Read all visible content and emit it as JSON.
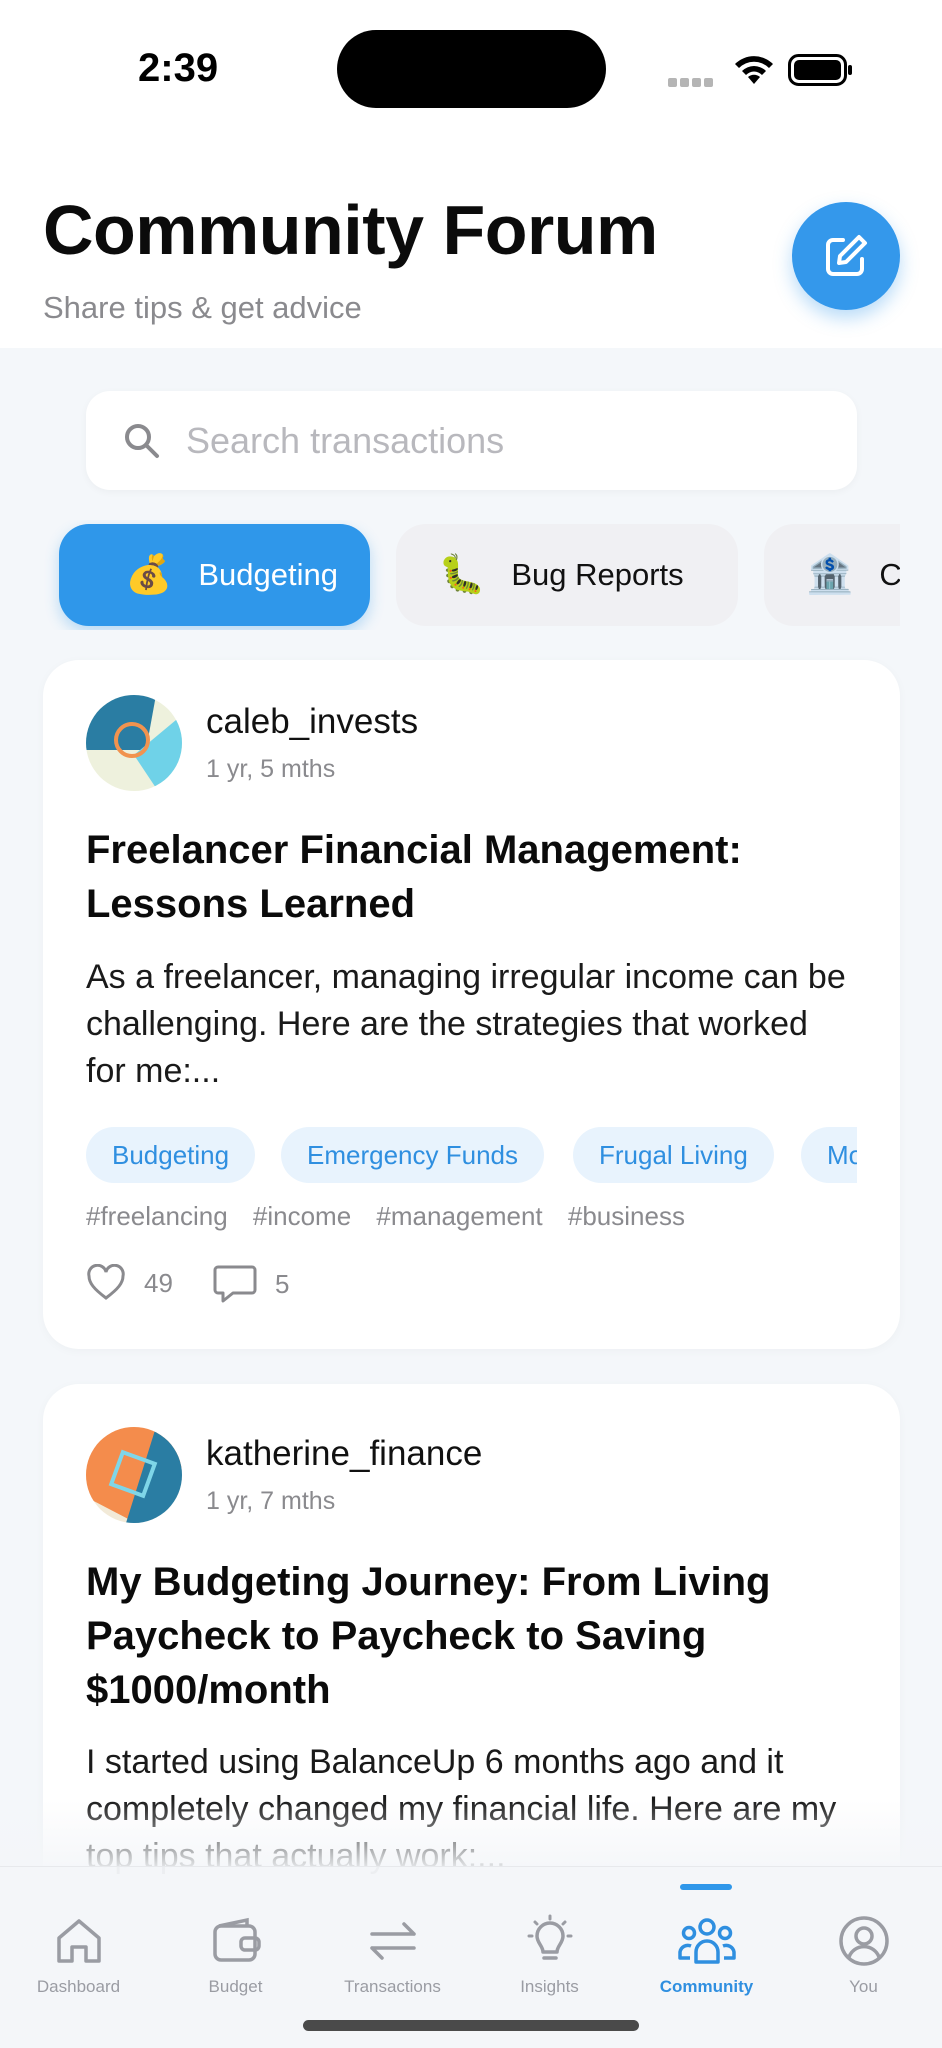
{
  "status_bar": {
    "time": "2:39"
  },
  "header": {
    "title": "Community Forum",
    "subtitle": "Share tips & get advice"
  },
  "search": {
    "placeholder": "Search transactions",
    "value": ""
  },
  "categories": [
    {
      "emoji": "💰",
      "label": "Budgeting",
      "active": true
    },
    {
      "emoji": "🐛",
      "label": "Bug Reports",
      "active": false
    },
    {
      "emoji": "🏦",
      "label": "C",
      "active": false
    }
  ],
  "posts": [
    {
      "username": "caleb_invests",
      "age": "1 yr, 5 mths",
      "title": "Freelancer Financial Management: Lessons Learned",
      "excerpt": "As a freelancer, managing irregular income can be challenging. Here are the strategies that worked for me:...",
      "tags": [
        "Budgeting",
        "Emergency Funds",
        "Frugal Living",
        "Mo"
      ],
      "hashtags": [
        "#freelancing",
        "#income",
        "#management",
        "#business"
      ],
      "likes": "49",
      "comments": "5"
    },
    {
      "username": "katherine_finance",
      "age": "1 yr, 7 mths",
      "title": "My Budgeting Journey: From Living Paycheck to Paycheck to Saving $1000/month",
      "excerpt": "I started using BalanceUp 6 months ago and it completely changed my financial life. Here are my top tips that actually work:..."
    }
  ],
  "tabbar": {
    "tabs": [
      {
        "label": "Dashboard",
        "icon": "home-icon"
      },
      {
        "label": "Budget",
        "icon": "wallet-icon"
      },
      {
        "label": "Transactions",
        "icon": "transfer-arrows-icon"
      },
      {
        "label": "Insights",
        "icon": "lightbulb-icon"
      },
      {
        "label": "Community",
        "icon": "people-icon",
        "active": true
      },
      {
        "label": "You",
        "icon": "user-circle-icon"
      }
    ]
  },
  "colors": {
    "accent": "#2f97ea",
    "tag_bg": "#e8f3fd",
    "muted": "#8a8a8e"
  }
}
